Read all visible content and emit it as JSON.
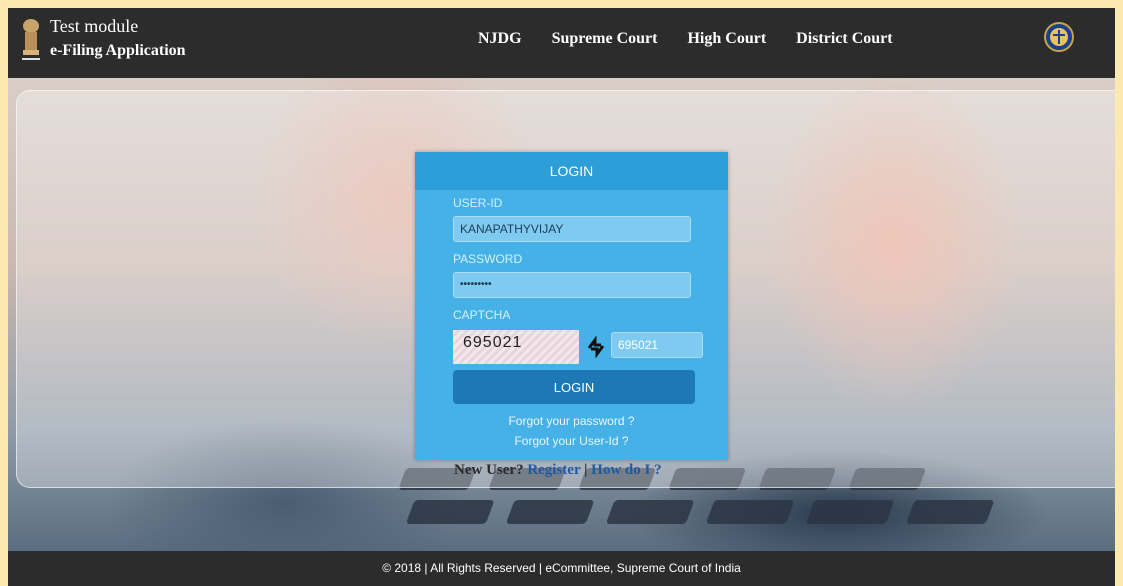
{
  "header": {
    "title": "Test module",
    "subtitle": "e-Filing Application",
    "nav": [
      "NJDG",
      "Supreme Court",
      "High Court",
      "District Court"
    ]
  },
  "login": {
    "heading": "LOGIN",
    "userid_label": "USER-ID",
    "userid_value": "KANAPATHYVIJAY",
    "password_label": "PASSWORD",
    "password_value": "•••••••••",
    "captcha_label": "CAPTCHA",
    "captcha_image_text": "695021",
    "captcha_value": "695021",
    "button_label": "LOGIN",
    "forgot_password": "Forgot your password ?",
    "forgot_userid": "Forgot your User-Id ?"
  },
  "new_user": {
    "prefix": "New User?",
    "register": "Register",
    "separator": "|",
    "how_do_i": "How do I ?"
  },
  "footer": {
    "text": "© 2018 | All Rights Reserved | eCommittee, Supreme Court of India"
  },
  "colors": {
    "header_bg": "#2c2c2c",
    "panel_bg": "#45b1e7",
    "panel_head": "#2e9ed8",
    "button_bg": "#1c79b5",
    "link_blue": "#1f5aa0"
  }
}
